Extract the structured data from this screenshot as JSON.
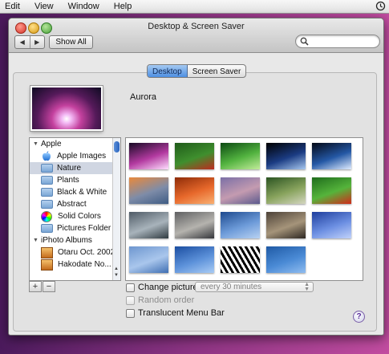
{
  "menubar": {
    "items": [
      "Edit",
      "View",
      "Window",
      "Help"
    ],
    "clock_icon": "time-machine-icon"
  },
  "window": {
    "title": "Desktop & Screen Saver",
    "show_all_label": "Show All",
    "search_placeholder": "",
    "tabs": [
      {
        "label": "Desktop",
        "selected": true
      },
      {
        "label": "Screen Saver",
        "selected": false
      }
    ]
  },
  "preview": {
    "name": "Aurora"
  },
  "source_list": {
    "rows": [
      {
        "label": "Apple",
        "kind": "group",
        "expanded": true
      },
      {
        "label": "Apple Images",
        "kind": "item",
        "icon": "apple-icon"
      },
      {
        "label": "Nature",
        "kind": "item",
        "icon": "folder-icon",
        "selected": true
      },
      {
        "label": "Plants",
        "kind": "item",
        "icon": "folder-icon"
      },
      {
        "label": "Black & White",
        "kind": "item",
        "icon": "folder-icon"
      },
      {
        "label": "Abstract",
        "kind": "item",
        "icon": "folder-icon"
      },
      {
        "label": "Solid Colors",
        "kind": "item",
        "icon": "color-wheel-icon"
      },
      {
        "label": "Pictures Folder",
        "kind": "item",
        "icon": "folder-icon"
      },
      {
        "label": "iPhoto Albums",
        "kind": "group",
        "expanded": true
      },
      {
        "label": "Otaru Oct. 2002",
        "kind": "item",
        "icon": "iphoto-album-icon"
      },
      {
        "label": "Hakodate  No...",
        "kind": "item",
        "icon": "iphoto-album-icon"
      }
    ],
    "add_label": "+",
    "remove_label": "−"
  },
  "thumbnails": [
    {
      "name": "aurora",
      "colors": [
        "#180a25",
        "#b33aa0",
        "#ffe0ff"
      ]
    },
    {
      "name": "ladybugs-on-leaves",
      "colors": [
        "#1f5b1a",
        "#3f8f2e",
        "#c02a1f"
      ]
    },
    {
      "name": "green-dewdrop",
      "colors": [
        "#0c4a12",
        "#53b340",
        "#c2ec9a"
      ]
    },
    {
      "name": "earth",
      "colors": [
        "#000000",
        "#1b3c83",
        "#a8c8ef"
      ]
    },
    {
      "name": "earth-horizon",
      "colors": [
        "#030816",
        "#2458a5",
        "#e0ecff"
      ]
    },
    {
      "name": "sunset-clouds",
      "colors": [
        "#e9893c",
        "#7e8ca8",
        "#3f5c84"
      ]
    },
    {
      "name": "orange-dunes",
      "colors": [
        "#8e2c08",
        "#e7682b",
        "#f9b072"
      ]
    },
    {
      "name": "sand-ripples",
      "colors": [
        "#7b6fa6",
        "#c49bb0",
        "#5b5a8d"
      ]
    },
    {
      "name": "hilltop-pagoda",
      "colors": [
        "#2b5422",
        "#88a35d",
        "#d4d6c0"
      ]
    },
    {
      "name": "ladybug-leaf",
      "colors": [
        "#1f6c1c",
        "#55b43b",
        "#d22a1a"
      ]
    },
    {
      "name": "lake-reeds",
      "colors": [
        "#4f5b66",
        "#a8b3bb",
        "#2f3a40"
      ]
    },
    {
      "name": "zen-stones",
      "colors": [
        "#5f6062",
        "#b5b3ae",
        "#34353a"
      ]
    },
    {
      "name": "blue-water",
      "colors": [
        "#1e4a8f",
        "#6d9bd9",
        "#b8d2f2"
      ]
    },
    {
      "name": "pebbles",
      "colors": [
        "#4d4238",
        "#a5947a",
        "#2d2722"
      ]
    },
    {
      "name": "blue-wave",
      "colors": [
        "#1e3e9d",
        "#6c8fe2",
        "#c1d2fa"
      ]
    },
    {
      "name": "calm-sea",
      "colors": [
        "#6d96cf",
        "#a9c6ec",
        "#3f6fb3"
      ]
    },
    {
      "name": "blue-mist",
      "colors": [
        "#1b4ea1",
        "#5d92da",
        "#a9ccf5"
      ]
    },
    {
      "name": "zebra",
      "colors": [
        "#000000",
        "#ffffff",
        "#555555"
      ]
    },
    {
      "name": "blue-ripples",
      "colors": [
        "#1f5aa5",
        "#4a8ad5",
        "#90bdf0"
      ]
    }
  ],
  "options": {
    "change_picture_label": "Change picture:",
    "change_picture_checked": false,
    "interval_value": "every 30 minutes",
    "random_order_label": "Random order",
    "random_order_enabled": false,
    "translucent_menu_bar_label": "Translucent Menu Bar",
    "translucent_menu_bar_checked": false
  },
  "help_label": "?"
}
